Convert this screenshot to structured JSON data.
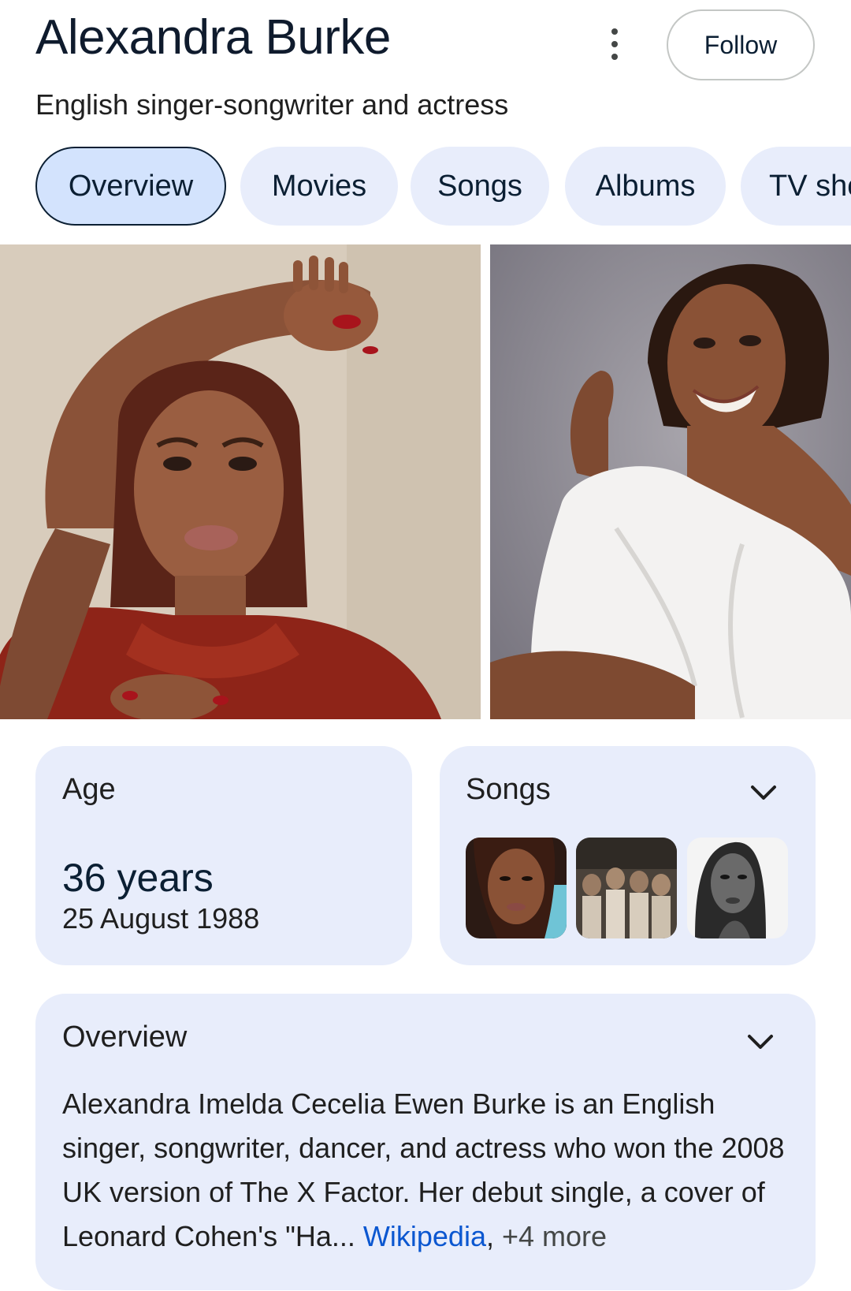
{
  "header": {
    "title": "Alexandra Burke",
    "subtitle": "English singer-songwriter and actress",
    "follow_label": "Follow",
    "menu_icon": "more-vert-icon"
  },
  "tabs": [
    {
      "label": "Overview",
      "active": true
    },
    {
      "label": "Movies",
      "active": false
    },
    {
      "label": "Songs",
      "active": false
    },
    {
      "label": "Albums",
      "active": false
    },
    {
      "label": "TV sho",
      "active": false
    }
  ],
  "age_card": {
    "label": "Age",
    "value": "36 years",
    "birth_date": "25 August 1988"
  },
  "songs_card": {
    "label": "Songs",
    "expand_icon": "chevron-down-icon"
  },
  "overview_card": {
    "label": "Overview",
    "text": "Alexandra Imelda Cecelia Ewen Burke is an English singer, songwriter, dancer, and actress who won the 2008 UK version of The X Factor. Her debut single, a cover of Leonard Cohen's \"Ha",
    "ellipsis": "... ",
    "source_link": "Wikipedia",
    "separator": ",",
    "more_sources": " +4 more",
    "expand_icon": "chevron-down-icon"
  },
  "colors": {
    "card_bg": "#e8edfb",
    "tab_active_bg": "#d3e3fd",
    "link": "#0b57d0",
    "title": "#0f1b2d"
  }
}
